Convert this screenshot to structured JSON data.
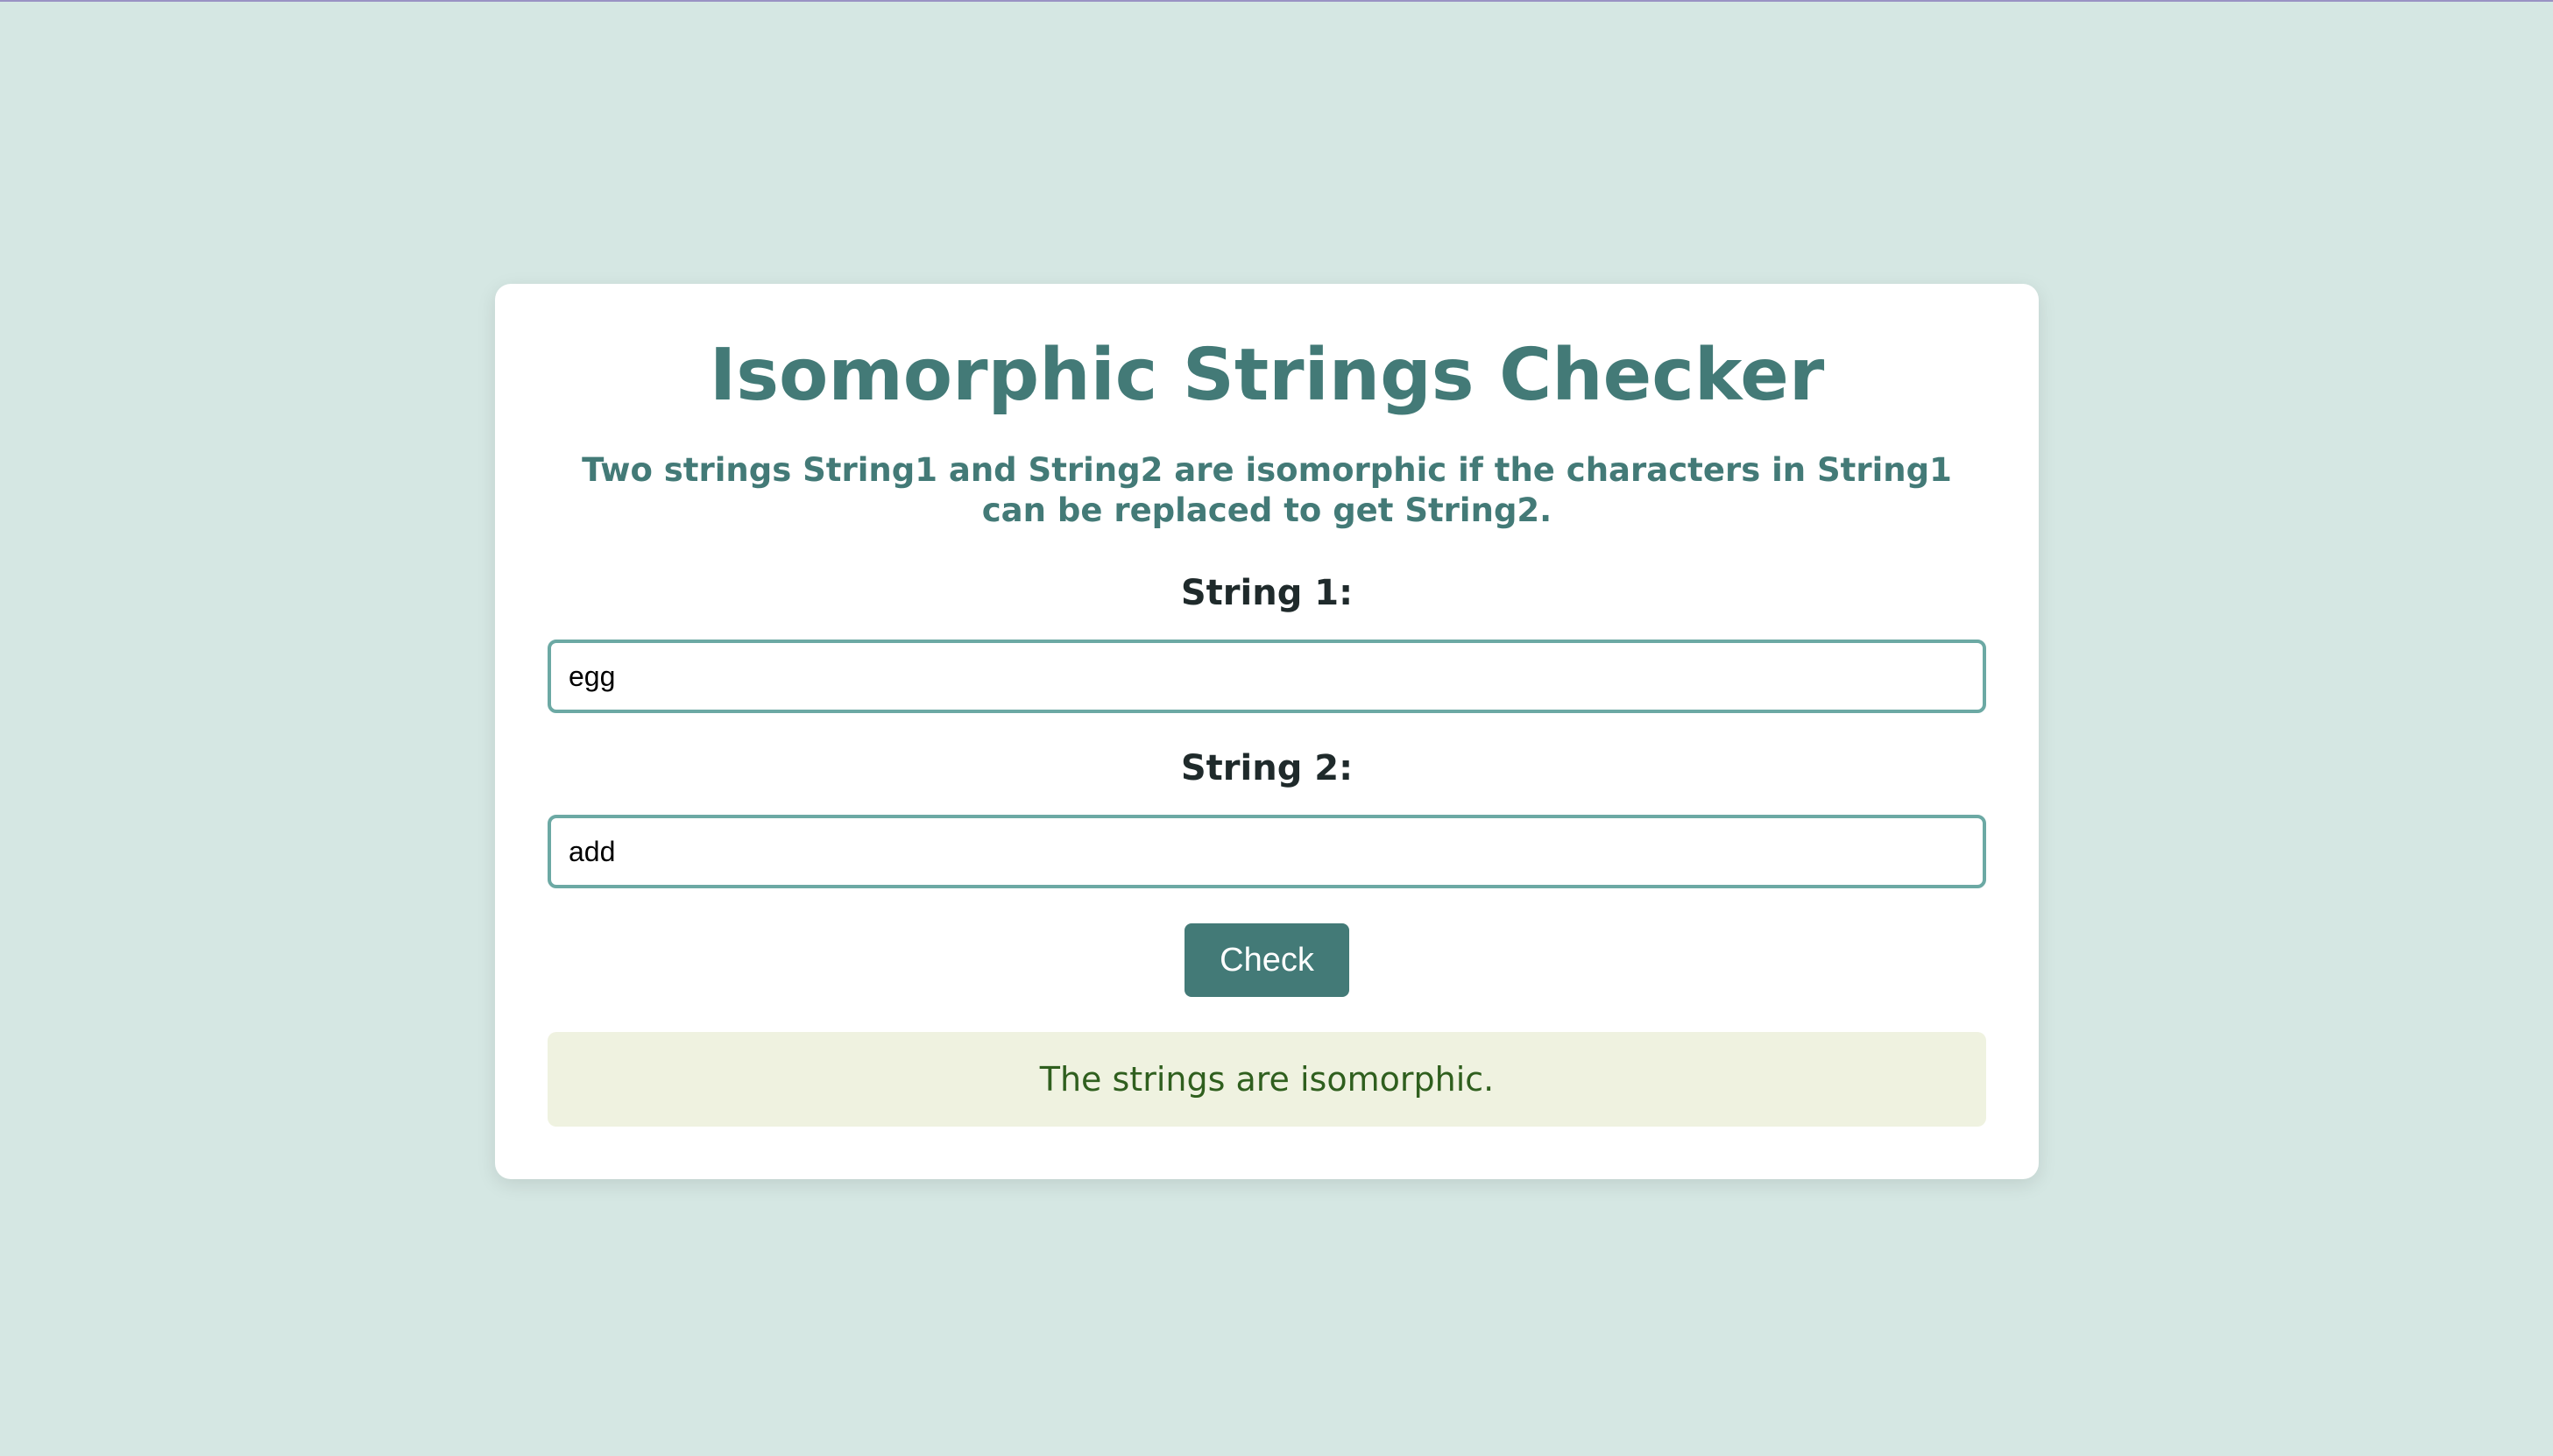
{
  "page": {
    "title": "Isomorphic Strings Checker",
    "description": "Two strings String1 and String2 are isomorphic if the characters in String1 can be replaced to get String2."
  },
  "form": {
    "string1_label": "String 1:",
    "string1_value": "egg",
    "string2_label": "String 2:",
    "string2_value": "add",
    "check_label": "Check"
  },
  "result": {
    "message": "The strings are isomorphic."
  },
  "colors": {
    "background": "#d5e7e3",
    "accent": "#437a77",
    "input_border": "#6ca9a4",
    "result_background": "#eff2e0",
    "result_text": "#2f5f1e"
  }
}
